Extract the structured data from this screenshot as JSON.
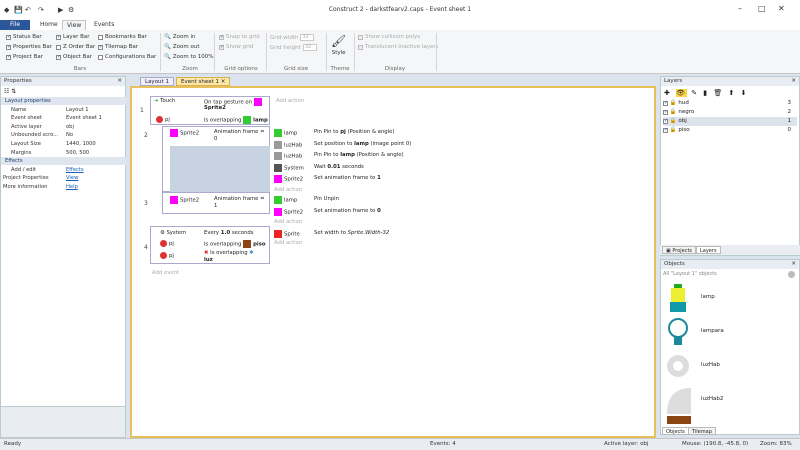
{
  "window": {
    "title": "Construct 2 - darkstfearv2.caps - Event sheet 1",
    "min": "–",
    "max": "□",
    "close": "✕"
  },
  "quick_access": [
    "💾",
    "↶",
    "↷",
    "▶",
    "⚙"
  ],
  "ribbon_tabs": [
    "File",
    "Home",
    "View",
    "Events"
  ],
  "ribbon": {
    "bars": {
      "items": [
        "Status Bar",
        "Properties Bar",
        "Project Bar",
        "Layer Bar",
        "Z Order Bar",
        "Object Bar",
        "Bookmarks Bar",
        "Tilemap Bar",
        "Configurations Bar"
      ],
      "label": "Bars"
    },
    "zoom": {
      "items": [
        "Zoom in",
        "Zoom out",
        "Zoom to 100%"
      ],
      "label": "Zoom"
    },
    "grid_options": {
      "items": [
        "Snap to grid",
        "Show grid"
      ],
      "label": "Grid options"
    },
    "grid_size": {
      "w_label": "Grid width",
      "w": "32",
      "h_label": "Grid height",
      "h": "32",
      "label": "Grid size"
    },
    "theme": {
      "style": "Style",
      "label": "Theme"
    },
    "display": {
      "items": [
        "Show collision polys",
        "Translucent inactive layers"
      ],
      "label": "Display"
    }
  },
  "properties": {
    "title": "Properties",
    "rows": [
      {
        "k": "Layout properties",
        "cat": true
      },
      {
        "k": "Name",
        "v": "Layout 1"
      },
      {
        "k": "Event sheet",
        "v": "Event sheet 1"
      },
      {
        "k": "Active layer",
        "v": "obj"
      },
      {
        "k": "Unbounded scro...",
        "v": "No"
      },
      {
        "k": "Layout Size",
        "v": "1440, 1000"
      },
      {
        "k": "Margins",
        "v": "500, 500"
      },
      {
        "k": "Effects",
        "cat": true
      },
      {
        "k": "Add / edit",
        "v": "Effects",
        "link": true
      },
      {
        "k": "Project Properties",
        "v": "View",
        "link": true,
        "top": true
      },
      {
        "k": "More information",
        "v": "Help",
        "link": true,
        "top": true
      }
    ]
  },
  "doc_tabs": [
    "Layout 1",
    "Event sheet 1"
  ],
  "events": {
    "e1": {
      "num": "1",
      "obj1": "Touch",
      "cond1": "On tap gesture on",
      "cond1b": "Sprite2",
      "obj2": "pj",
      "cond2": "Is overlapping",
      "cond2b": "lamp",
      "add": "Add action"
    },
    "e2": {
      "num": "2",
      "obj": "Sprite2",
      "cond": "Animation frame =",
      "cond_b": "0",
      "actions": [
        {
          "o": "lamp",
          "a": "Pin Pin to",
          "b": "pj",
          "c": "(Position & angle)"
        },
        {
          "o": "luzHab",
          "a": "Set position to",
          "b": "lamp",
          "c": "(image point 0)"
        },
        {
          "o": "luzHab",
          "a": "Pin Pin to",
          "b": "lamp",
          "c": "(Position & angle)"
        },
        {
          "o": "System",
          "a": "Wait",
          "b": "0.01",
          "c": "seconds"
        },
        {
          "o": "Sprite2",
          "a": "Set animation frame to",
          "b": "1",
          "c": ""
        }
      ],
      "add": "Add action"
    },
    "e3": {
      "num": "3",
      "obj": "Sprite2",
      "cond": "Animation frame =",
      "cond_b": "1",
      "actions": [
        {
          "o": "lamp",
          "a": "Pin Unpin",
          "b": "",
          "c": ""
        },
        {
          "o": "Sprite2",
          "a": "Set animation frame to",
          "b": "0",
          "c": ""
        }
      ],
      "add": "Add action"
    },
    "e4": {
      "num": "4",
      "c1o": "System",
      "c1": "Every",
      "c1b": "1.0",
      "c1c": "seconds",
      "c2o": "pj",
      "c2": "Is overlapping",
      "c2b": "piso",
      "c3o": "pj",
      "c3": "Is overlapping",
      "c3b": "luz",
      "action_o": "Sprite",
      "action": "Set width to",
      "action_b": "Sprite.Width-32",
      "add": "Add action"
    },
    "add_event": "Add event"
  },
  "layers": {
    "title": "Layers",
    "rows": [
      {
        "name": "hud",
        "n": "3"
      },
      {
        "name": "negro",
        "n": "2"
      },
      {
        "name": "obj",
        "n": "1"
      },
      {
        "name": "piso",
        "n": "0"
      }
    ]
  },
  "project_tabs": [
    "Projects",
    "Layers"
  ],
  "objects": {
    "title": "Objects",
    "filter": "All \"Layout 1\" objects",
    "items": [
      "lamp",
      "lampara",
      "luzHab",
      "luzHab2"
    ]
  },
  "object_tabs": [
    "Objects",
    "Tilemap"
  ],
  "status": {
    "ready": "Ready",
    "events": "Events: 4",
    "layer": "Active layer: obj",
    "mouse": "Mouse: (190.8, -45.8, 0)",
    "zoom": "Zoom: 83%"
  }
}
